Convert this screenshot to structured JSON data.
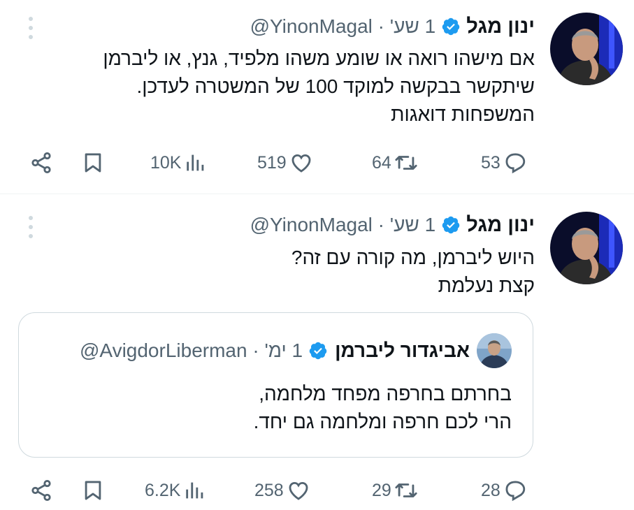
{
  "tweets": [
    {
      "display_name": "ינון מגל",
      "handle": "@YinonMagal",
      "separator": "·",
      "time": "1 שע'",
      "text_lines": [
        "אם מישהו רואה או שומע משהו מלפיד, גנץ, או ליברמן",
        "שיתקשר בבקשה למוקד 100 של המשטרה לעדכן.",
        "המשפחות דואגות"
      ],
      "stats": {
        "replies": "53",
        "retweets": "64",
        "likes": "519",
        "views": "10K"
      }
    },
    {
      "display_name": "ינון מגל",
      "handle": "@YinonMagal",
      "separator": "·",
      "time": "1 שע'",
      "text_lines": [
        "היוש ליברמן, מה קורה עם זה?",
        "קצת נעלמת"
      ],
      "quoted": {
        "display_name": "אביגדור ליברמן",
        "handle": "@AvigdorLiberman",
        "separator": "·",
        "time": "1 ימ'",
        "text_lines": [
          "בחרתם בחרפה מפחד מלחמה,",
          "הרי לכם חרפה ומלחמה גם יחד."
        ]
      },
      "stats": {
        "replies": "28",
        "retweets": "29",
        "likes": "258",
        "views": "6.2K"
      }
    }
  ],
  "icons": {
    "verified": "verified-badge-icon",
    "more": "more-options-icon",
    "reply": "reply-icon",
    "retweet": "retweet-icon",
    "like": "like-icon",
    "views": "views-icon",
    "bookmark": "bookmark-icon",
    "share": "share-icon"
  },
  "colors": {
    "text": "#0f1419",
    "secondary": "#536471",
    "verified": "#1d9bf0",
    "border": "#cfd9de"
  }
}
